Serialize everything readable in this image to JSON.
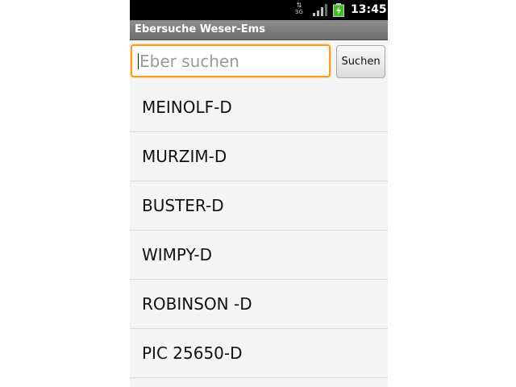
{
  "status_bar": {
    "network_label": "3G",
    "network_icon": "data-3g-icon",
    "signal_icon": "signal-strength-icon",
    "battery_icon": "battery-charging-icon",
    "time": "13:45"
  },
  "app": {
    "title": "Ebersuche Weser-Ems"
  },
  "search": {
    "placeholder": "Eber suchen",
    "value": "",
    "button_label": "Suchen",
    "focus_color": "#ff9a1a"
  },
  "results": [
    {
      "label": "MEINOLF-D"
    },
    {
      "label": "MURZIM-D"
    },
    {
      "label": "BUSTER-D"
    },
    {
      "label": "WIMPY-D"
    },
    {
      "label": "ROBINSON -D"
    },
    {
      "label": "PIC 25650-D"
    }
  ]
}
